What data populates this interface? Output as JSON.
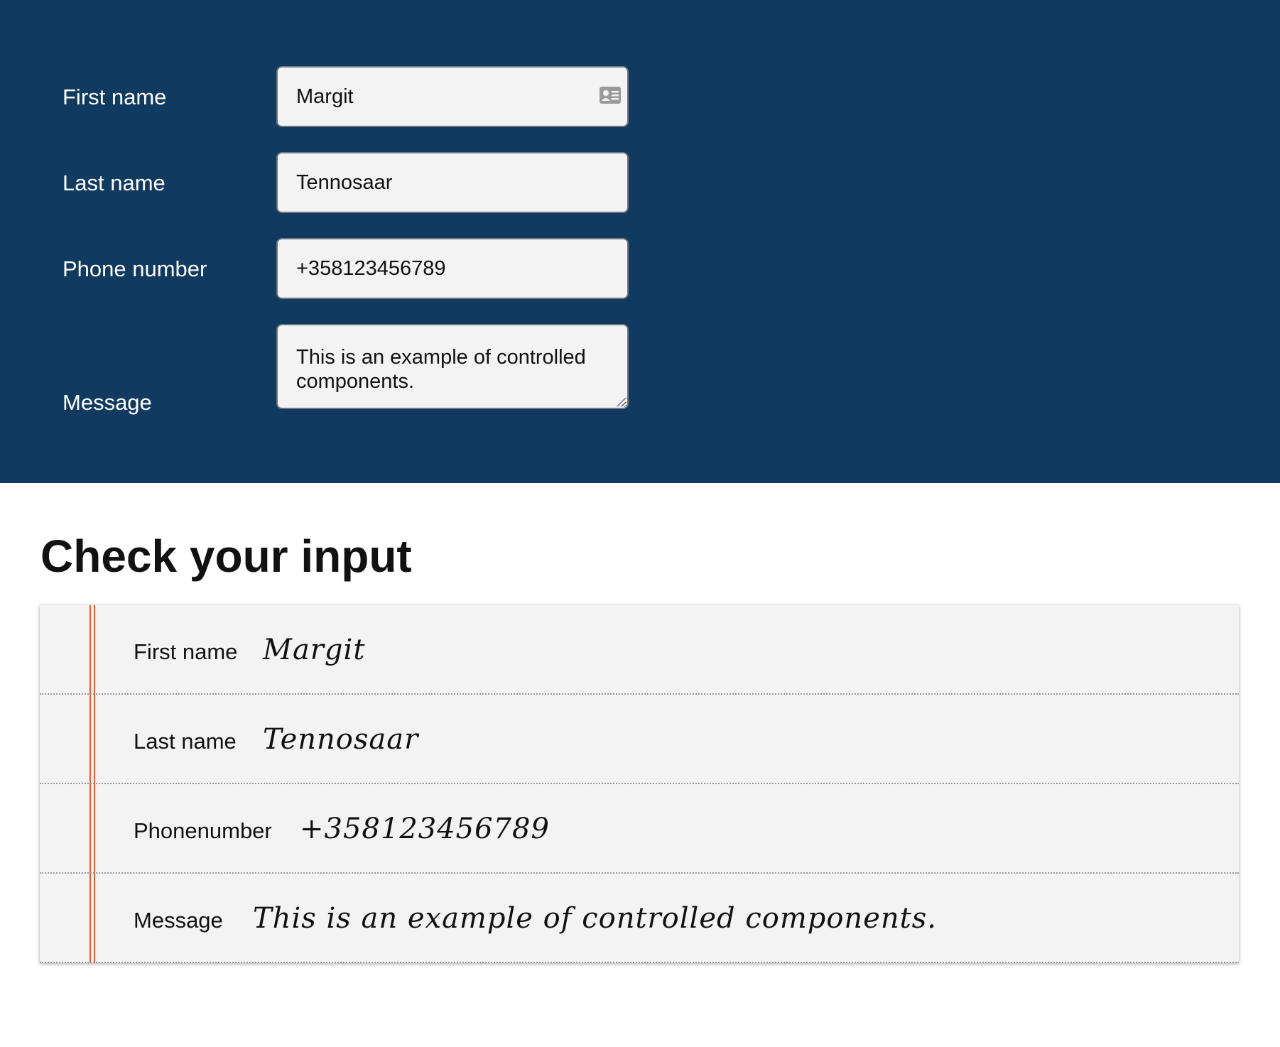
{
  "form": {
    "first_name": {
      "label": "First name",
      "value": "Margit"
    },
    "last_name": {
      "label": "Last name",
      "value": "Tennosaar"
    },
    "phone": {
      "label": "Phone number",
      "value": "+358123456789"
    },
    "message": {
      "label": "Message",
      "value": "This is an example of controlled components."
    },
    "contact_icon": "contact-card-icon",
    "panel_color": "#103a5f"
  },
  "check": {
    "title": "Check your input",
    "rows": [
      {
        "label": "First name",
        "value": "Margit"
      },
      {
        "label": "Last name",
        "value": "Tennosaar"
      },
      {
        "label": "Phonenumber",
        "value": "+358123456789"
      },
      {
        "label": "Message",
        "value": "This is an example of controlled components."
      }
    ],
    "margin_line_color": "#e05a2b"
  }
}
